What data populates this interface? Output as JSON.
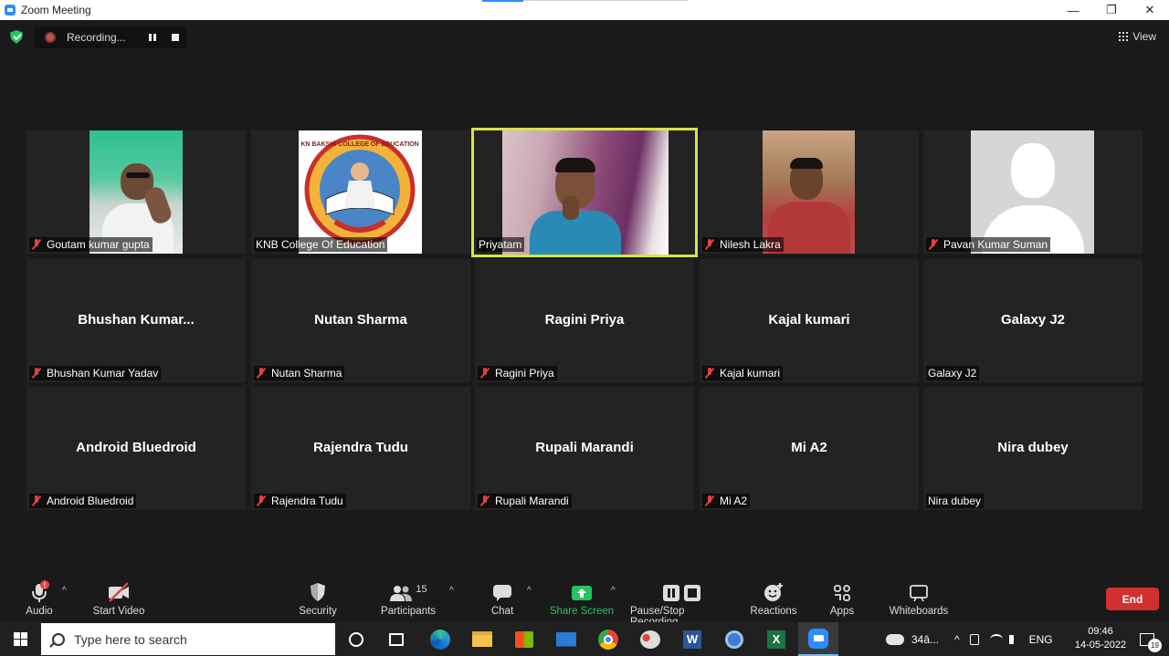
{
  "window": {
    "title": "Zoom Meeting",
    "minimize": "—",
    "restore": "❐",
    "close": "✕"
  },
  "recording": {
    "label": "Recording..."
  },
  "view": {
    "label": "View"
  },
  "tiles": [
    {
      "big": "",
      "name": "Goutam kumar gupta",
      "muted": true
    },
    {
      "big": "",
      "name": "KNB College Of Education",
      "muted": false
    },
    {
      "big": "",
      "name": "Priyatam",
      "muted": false
    },
    {
      "big": "",
      "name": "Nilesh Lakra",
      "muted": true
    },
    {
      "big": "",
      "name": "Pavan Kumar Suman",
      "muted": true
    },
    {
      "big": "Bhushan  Kumar...",
      "name": "Bhushan Kumar Yadav",
      "muted": true
    },
    {
      "big": "Nutan Sharma",
      "name": "Nutan Sharma",
      "muted": true
    },
    {
      "big": "Ragini Priya",
      "name": "Ragini Priya",
      "muted": true
    },
    {
      "big": "Kajal kumari",
      "name": "Kajal kumari",
      "muted": true
    },
    {
      "big": "Galaxy J2",
      "name": "Galaxy J2",
      "muted": false
    },
    {
      "big": "Android Bluedroid",
      "name": "Android Bluedroid",
      "muted": true
    },
    {
      "big": "Rajendra Tudu",
      "name": "Rajendra Tudu",
      "muted": true
    },
    {
      "big": "Rupali Marandi",
      "name": "Rupali Marandi",
      "muted": true
    },
    {
      "big": "Mi A2",
      "name": "Mi A2",
      "muted": true
    },
    {
      "big": "Nira dubey",
      "name": "Nira dubey",
      "muted": false
    }
  ],
  "logo": {
    "arc_text": "KN BAKSHI COLLEGE OF EDUCATION"
  },
  "toolbar": {
    "audio": "Audio",
    "audio_badge": "!",
    "start_video": "Start Video",
    "security": "Security",
    "participants": "Participants",
    "participants_count": "15",
    "chat": "Chat",
    "share_screen": "Share Screen",
    "pause_stop_recording": "Pause/Stop Recording",
    "reactions": "Reactions",
    "apps": "Apps",
    "whiteboards": "Whiteboards",
    "end": "End",
    "caret": "^"
  },
  "taskbar": {
    "search_placeholder": "Type here to search",
    "weather": "34â...",
    "lang": "ENG",
    "time": "09:46",
    "date": "14-05-2022",
    "notifications": "19"
  },
  "colors": {
    "accent": "#2d8cff",
    "active_speaker": "#d8e24a",
    "end": "#d32f2f",
    "share": "#23c55e",
    "muted": "#e2443b"
  }
}
